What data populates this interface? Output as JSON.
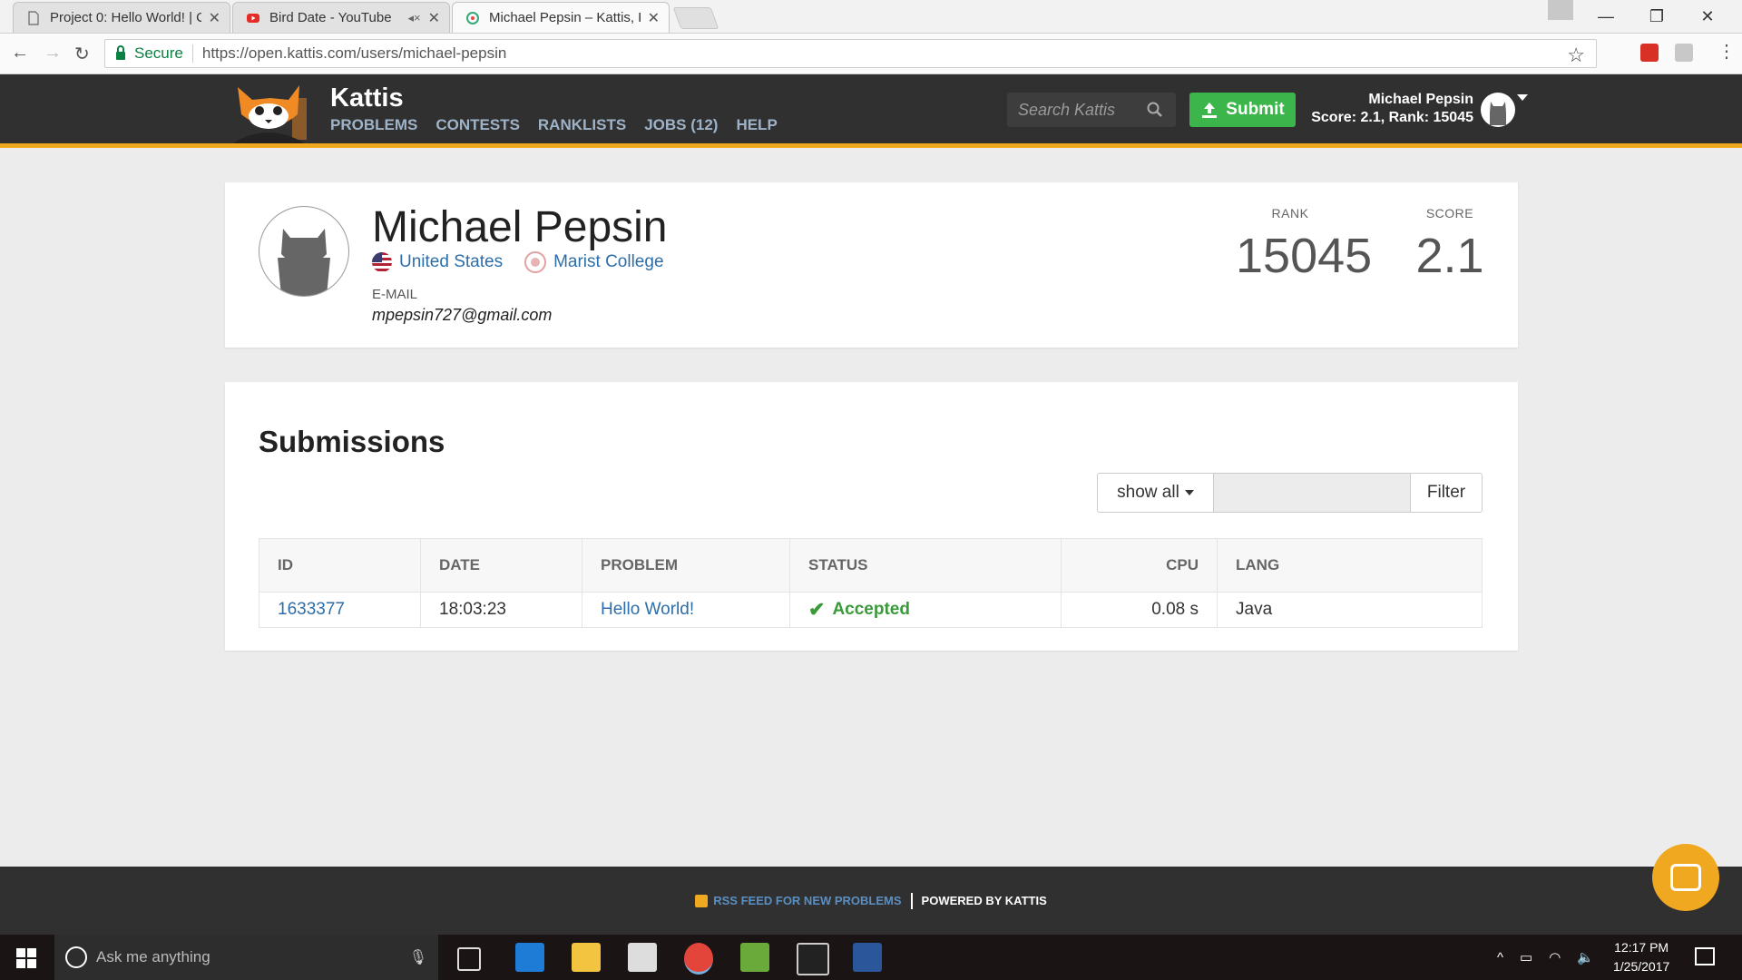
{
  "browser": {
    "tabs": [
      {
        "label": "Project 0: Hello World! | C"
      },
      {
        "label": "Bird Date - YouTube"
      },
      {
        "label": "Michael Pepsin – Kattis, K"
      }
    ],
    "address": {
      "secure_label": "Secure",
      "url": "https://open.kattis.com/users/michael-pepsin"
    }
  },
  "site": {
    "brand": "Kattis",
    "nav": [
      "PROBLEMS",
      "CONTESTS",
      "RANKLISTS",
      "JOBS (12)",
      "HELP"
    ],
    "search_placeholder": "Search Kattis",
    "submit_label": "Submit",
    "user": {
      "name": "Michael Pepsin",
      "summary": "Score: 2.1, Rank: 15045"
    }
  },
  "profile": {
    "name": "Michael Pepsin",
    "country": "United States",
    "school": "Marist College",
    "email_label": "E-MAIL",
    "email": "mpepsin727@gmail.com",
    "rank_label": "RANK",
    "rank": "15045",
    "score_label": "SCORE",
    "score": "2.1"
  },
  "submissions": {
    "title": "Submissions",
    "filter_select": "show all",
    "filter_button": "Filter",
    "columns": [
      "ID",
      "DATE",
      "PROBLEM",
      "STATUS",
      "CPU",
      "LANG"
    ],
    "rows": [
      {
        "id": "1633377",
        "date": "18:03:23",
        "problem": "Hello World!",
        "status": "Accepted",
        "cpu": "0.08 s",
        "lang": "Java"
      }
    ]
  },
  "footer": {
    "rss": "RSS FEED FOR NEW PROBLEMS",
    "powered": "POWERED BY KATTIS"
  },
  "taskbar": {
    "search_placeholder": "Ask me anything",
    "time": "12:17 PM",
    "date": "1/25/2017"
  },
  "colors": {
    "accent": "#f0a820",
    "submit": "#3cb54a",
    "link": "#2e6ea8",
    "accepted": "#3a9a3a",
    "header_bg": "#303030"
  }
}
